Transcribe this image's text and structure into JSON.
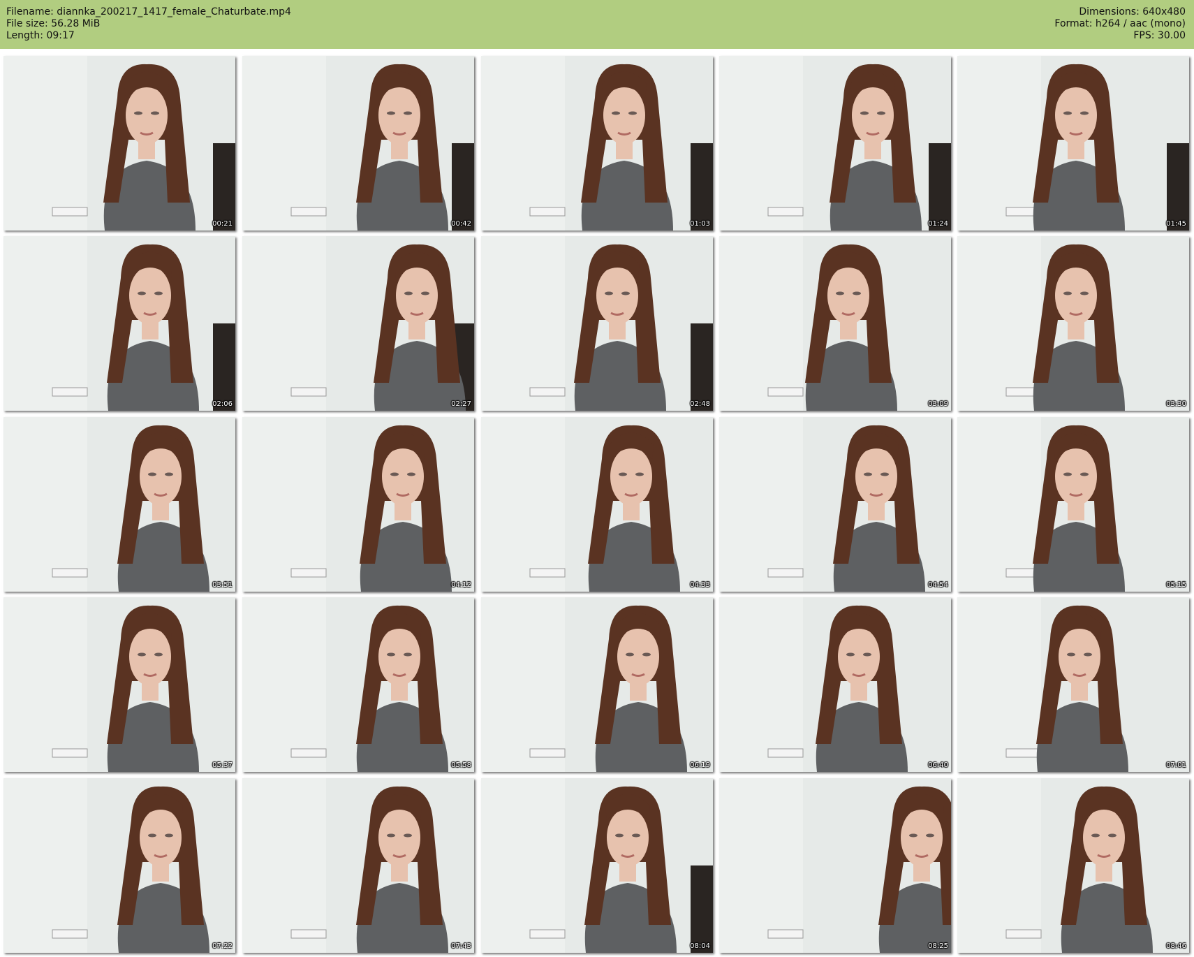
{
  "header": {
    "filename": "Filename: diannka_200217_1417_female_Chaturbate.mp4",
    "filesize": "File size: 56.28 MiB",
    "length": "Length: 09:17",
    "dimensions": "Dimensions: 640x480",
    "format": "Format: h264 / aac (mono)",
    "fps": "FPS: 30.00"
  },
  "timestamps": [
    "00:21",
    "00:42",
    "01:03",
    "01:24",
    "01:45",
    "02:06",
    "02:27",
    "02:48",
    "03:09",
    "03:30",
    "03:51",
    "04:12",
    "04:33",
    "04:54",
    "05:15",
    "05:37",
    "05:58",
    "06:19",
    "06:40",
    "07:01",
    "07:22",
    "07:43",
    "08:04",
    "08:25",
    "08:46"
  ],
  "colors": {
    "header_bg": "#b1cd80",
    "wall": "#e6eae8",
    "hair": "#5a3322",
    "sweater": "#5e6062",
    "skin": "#e7c2ae",
    "chair": "#2a2522"
  }
}
